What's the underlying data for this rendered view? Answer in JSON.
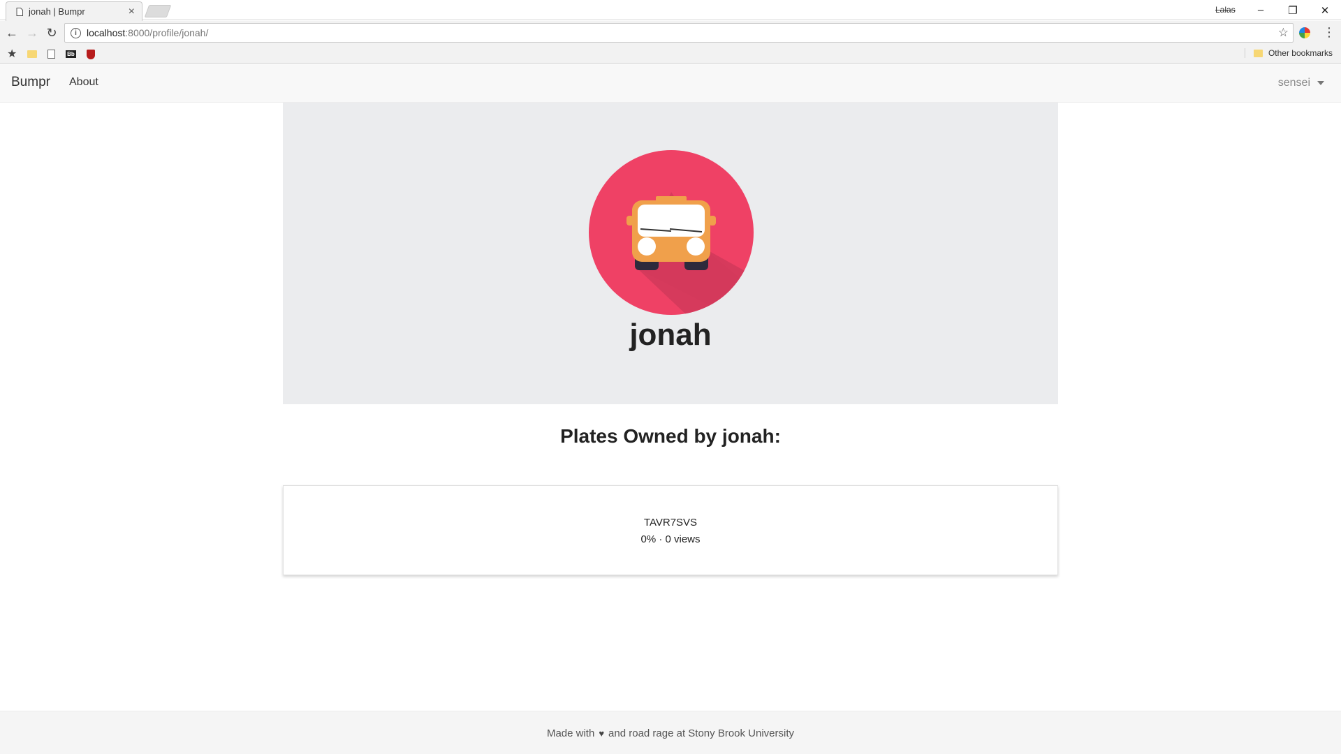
{
  "browser": {
    "tab_title": "jonah | Bumpr",
    "tab_close": "×",
    "window_user": "Lalas",
    "url_host": "localhost",
    "url_path": ":8000/profile/jonah/",
    "other_bookmarks": "Other bookmarks",
    "bb_label": "Bb"
  },
  "navbar": {
    "brand": "Bumpr",
    "about": "About",
    "user": "sensei"
  },
  "profile": {
    "username": "jonah"
  },
  "plates": {
    "heading_prefix": "Plates Owned by ",
    "heading_name": "jonah",
    "heading_suffix": ":",
    "items": [
      {
        "plate": "TAVR7SVS",
        "stats": "0% · 0 views"
      }
    ]
  },
  "footer": {
    "made_with": "Made with",
    "heart": "♥",
    "rest": "and road rage at Stony Brook University"
  },
  "colors": {
    "avatar_bg": "#ef4165",
    "bus_body": "#f0a04b",
    "hero_bg": "#ebecee"
  }
}
